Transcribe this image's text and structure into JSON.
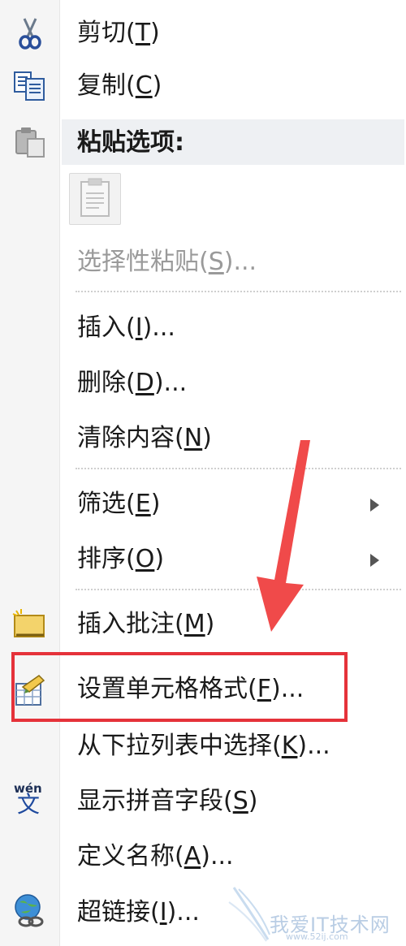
{
  "menu": {
    "cut": {
      "label": "剪切(",
      "key": "T",
      "suffix": ")"
    },
    "copy": {
      "label": "复制(",
      "key": "C",
      "suffix": ")"
    },
    "paste_options": {
      "label": "粘贴选项:"
    },
    "paste_special": {
      "label": "选择性粘贴(",
      "key": "S",
      "suffix": ")..."
    },
    "insert": {
      "label": "插入(",
      "key": "I",
      "suffix": ")..."
    },
    "delete": {
      "label": "删除(",
      "key": "D",
      "suffix": ")..."
    },
    "clear": {
      "label": "清除内容(",
      "key": "N",
      "suffix": ")"
    },
    "filter": {
      "label": "筛选(",
      "key": "E",
      "suffix": ")"
    },
    "sort": {
      "label": "排序(",
      "key": "O",
      "suffix": ")"
    },
    "insert_comment": {
      "label": "插入批注(",
      "key": "M",
      "suffix": ")"
    },
    "format_cells": {
      "label": "设置单元格格式(",
      "key": "F",
      "suffix": ")..."
    },
    "pick_from_list": {
      "label": "从下拉列表中选择(",
      "key": "K",
      "suffix": ")..."
    },
    "phonetic": {
      "label": "显示拼音字段(",
      "key": "S",
      "suffix": ")"
    },
    "define_name": {
      "label": "定义名称(",
      "key": "A",
      "suffix": ")..."
    },
    "hyperlink": {
      "label": "超链接(",
      "key": "I",
      "suffix": ")..."
    }
  },
  "icons": {
    "cut": "scissors-icon",
    "copy": "copy-icon",
    "paste": "clipboard-icon",
    "insert_comment": "comment-icon",
    "format_cells": "format-cells-icon",
    "phonetic": "phonetic-icon",
    "hyperlink": "hyperlink-icon"
  },
  "phonetic_icon_text": {
    "top": "wén",
    "bottom": "文"
  },
  "watermark": {
    "text": "我爱IT技术网",
    "url": "www.52ij.com"
  },
  "colors": {
    "highlight": "#e5323a",
    "arrow": "#f04a4a",
    "disabled": "#9a9a9a"
  }
}
